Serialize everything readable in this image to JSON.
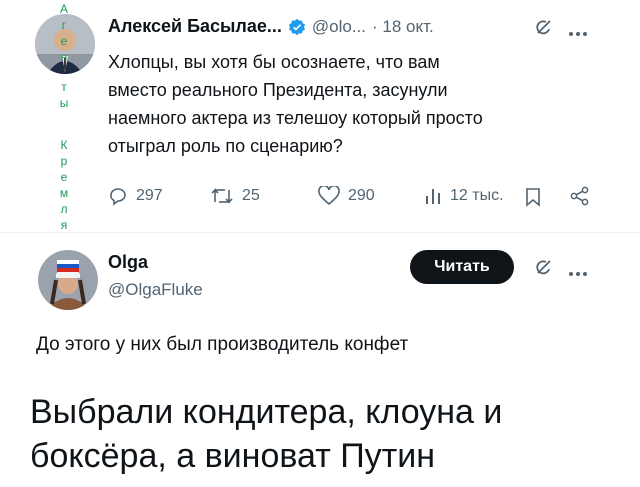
{
  "colors": {
    "verified": "#1d9bf0",
    "text": "#0f1419",
    "muted": "#536471",
    "watermark": "#1d9b50"
  },
  "watermark_letters": [
    "А",
    "г",
    "е",
    "н",
    "т",
    "ы",
    "К",
    "р",
    "е",
    "м",
    "л",
    "я"
  ],
  "tweet1": {
    "author": "Алексей Басылае...",
    "handle": "@olo...",
    "time": "· 18 окт.",
    "text_lines": [
      "Хлопцы, вы хотя бы осознаете, что вам",
      "вместо реального Президента, засунули",
      "наемного актера из телешоу который просто",
      "отыграл роль по сценарию?"
    ],
    "stats": {
      "replies": "297",
      "retweets": "25",
      "likes": "290",
      "views": "12 тыс."
    },
    "icons": [
      "grok-icon",
      "more-icon",
      "reply-icon",
      "retweet-icon",
      "like-icon",
      "views-icon",
      "bookmark-icon",
      "share-icon"
    ]
  },
  "tweet2": {
    "author": "Olga",
    "handle": "@OlgaFluke",
    "follow_label": "Читать",
    "text": "До этого у них был производитель конфет"
  },
  "caption": {
    "line1": "Выбрали кондитера, клоуна и",
    "line2": "боксёра, а виноват Путин"
  }
}
